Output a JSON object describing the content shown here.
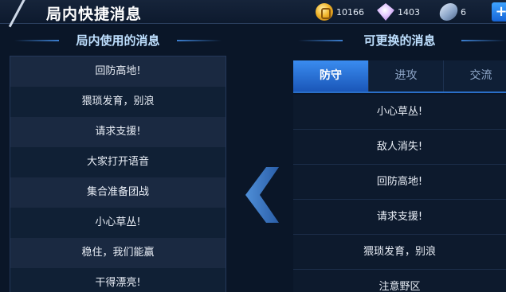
{
  "header": {
    "title": "局内快捷消息"
  },
  "currencies": {
    "gold": "10166",
    "diamonds": "1403",
    "vouchers": "6"
  },
  "left": {
    "title": "局内使用的消息",
    "items": [
      "回防高地!",
      "猥琐发育，别浪",
      "请求支援!",
      "大家打开语音",
      "集合准备团战",
      "小心草丛!",
      "稳住，我们能赢",
      "干得漂亮!"
    ]
  },
  "right": {
    "title": "可更换的消息",
    "tabs": [
      "防守",
      "进攻",
      "交流"
    ],
    "active_tab": "防守",
    "items": [
      "小心草丛!",
      "敌人消失!",
      "回防高地!",
      "请求支援!",
      "猥琐发育，别浪",
      "注意野区"
    ]
  },
  "icons": {
    "back": "back-slash-icon",
    "gold": "gold-coin-icon",
    "diamond": "diamond-icon",
    "voucher": "voucher-icon",
    "add": "plus-icon",
    "move": "left-chevron-icon"
  },
  "colors": {
    "background": "#0a1628",
    "accent": "#2a6fc8",
    "title_text": "#bfe0ff"
  }
}
